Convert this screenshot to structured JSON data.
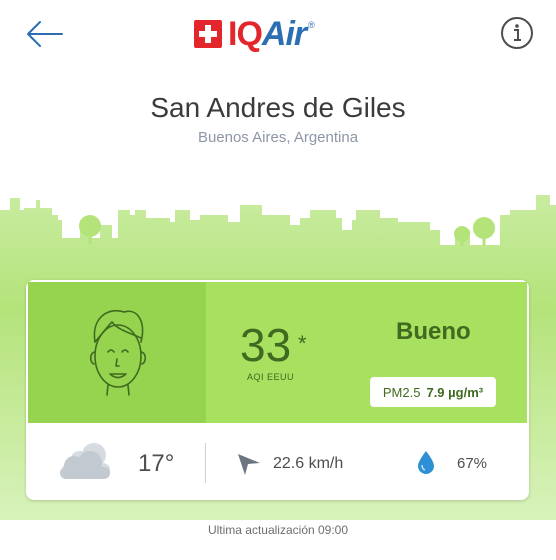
{
  "header": {
    "logo_text_iq": "IQ",
    "logo_text_air": "Air",
    "logo_reg": "®"
  },
  "location": {
    "city": "San Andres de Giles",
    "region": "Buenos Aires, Argentina"
  },
  "aqi": {
    "value": "33",
    "star": "*",
    "label": "AQI EEUU",
    "status": "Bueno",
    "pollutant": "PM2.5",
    "concentration": "7.9 µg/m³"
  },
  "weather": {
    "temperature": "17°",
    "wind": "22.6 km/h",
    "humidity": "67%"
  },
  "footer": {
    "updated": "Ultima actualización 09:00"
  },
  "colors": {
    "good_dark": "#96d44f",
    "good_light": "#a8e05f",
    "good_text": "#3f6a1f",
    "brand_red": "#e2262b",
    "brand_blue": "#2b6fb2"
  },
  "icons": [
    "back-arrow-icon",
    "info-icon",
    "face-icon",
    "cloud-icon",
    "wind-direction-icon",
    "humidity-drop-icon"
  ]
}
